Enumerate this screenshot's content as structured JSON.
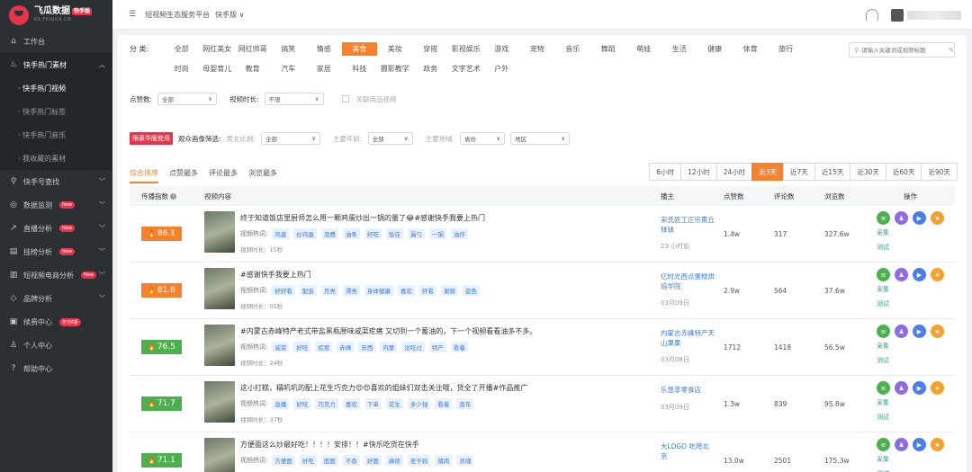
{
  "brand": {
    "name": "飞瓜数据",
    "edition": "快手版",
    "url": "KS.FEIGUA.CN"
  },
  "sidebar": {
    "items": [
      {
        "label": "工作台",
        "icon": "home-icon"
      },
      {
        "label": "快手热门素材",
        "icon": "fire-icon"
      },
      {
        "label": "快手号查找",
        "icon": "search-icon"
      },
      {
        "label": "数据监测",
        "icon": "monitor-icon",
        "badge": "New"
      },
      {
        "label": "直播分析",
        "icon": "live-icon",
        "badge": "New"
      },
      {
        "label": "挂榜分析",
        "icon": "chart-icon",
        "badge": "New"
      },
      {
        "label": "短视频电商分析",
        "icon": "bar-chart-icon",
        "badge": "New"
      },
      {
        "label": "品牌分析",
        "icon": "diamond-icon"
      },
      {
        "label": "续费中心",
        "icon": "wallet-icon",
        "badge": "年付6折"
      },
      {
        "label": "个人中心",
        "icon": "user-icon"
      },
      {
        "label": "帮助中心",
        "icon": "help-icon"
      }
    ],
    "subitems": [
      "· 快手热门视频",
      "· 快手热门标签",
      "· 快手热门音乐",
      "· 我收藏的素材"
    ]
  },
  "topbar": {
    "breadcrumb": "短视频生态服务平台",
    "platform": "快手版 ∨"
  },
  "filters": {
    "category_label": "分 类:",
    "categories": [
      "全部",
      "网红美女",
      "网红帅哥",
      "搞笑",
      "情感",
      "美食",
      "美妆",
      "穿搭",
      "影视娱乐",
      "游戏",
      "宠物",
      "音乐",
      "舞蹈",
      "萌娃",
      "生活",
      "健康",
      "体育",
      "旅行",
      "时尚",
      "母婴育儿",
      "教育",
      "汽车",
      "家居",
      "科技",
      "摄影教学",
      "政务",
      "文字艺术",
      "户外"
    ],
    "selected_category": "美食",
    "search_placeholder": "请输入关键词或视频标题",
    "likes_label": "点赞数:",
    "likes_value": "全部",
    "duration_label": "视频时长:",
    "duration_value": "不限",
    "linked_goods": "关联商品视频",
    "vip_tag": "限豪华版使用",
    "audience_label": "观众画像筛选:",
    "gender_label": "男女比例:",
    "gender_value": "全部",
    "age_label": "主要年龄:",
    "age_value": "全部",
    "region_label": "主要地域:",
    "region_value": "省份",
    "city_value": "地区"
  },
  "sort_tabs": [
    "综合排序",
    "点赞最多",
    "评论最多",
    "浏览最多"
  ],
  "time_ranges": [
    "6小时",
    "12小时",
    "24小时",
    "近3天",
    "近7天",
    "近15天",
    "近30天",
    "近60天",
    "近90天"
  ],
  "selected_range": "近3天",
  "table": {
    "headers": {
      "spread": "传播指数",
      "content": "视频内容",
      "author": "播主",
      "likes": "点赞数",
      "comments": "评论数",
      "views": "浏览数",
      "ops": "操作"
    },
    "hot_label": "视频热词:",
    "collect": "采集",
    "test": "测试",
    "rows": [
      {
        "score": "86.1",
        "color": "orange",
        "title": "终于知道饭店里厨师怎么用一颗鸡蛋炒出一锅的量了😂#感谢快手我要上热门",
        "keywords": [
          "鸡蛋",
          "炒鸡蛋",
          "浪费",
          "油条",
          "好吃",
          "饭店",
          "漏勺",
          "一锅",
          "油炸"
        ],
        "duration": "视频时长：15秒",
        "author": "宋氏匠工正宗熏丘钵钵",
        "date": "23 小时前",
        "likes": "1.4w",
        "comments": "317",
        "views": "327.6w"
      },
      {
        "score": "81.6",
        "color": "orange",
        "title": "#感谢快手我要上热门",
        "keywords": [
          "好好看",
          "配音",
          "月亮",
          "漂亮",
          "身体健康",
          "喜欢",
          "好看",
          "谢谢",
          "蓝色"
        ],
        "duration": "视频时长：55秒",
        "author": "亿时光西点蛋糕烘焙学院",
        "date": "03月09日",
        "likes": "2.9w",
        "comments": "564",
        "views": "37.6w"
      },
      {
        "score": "76.5",
        "color": "green",
        "title": "#内蒙古赤峰特产老式带盐黑瓶原味咸菜疙瘩 又切到一个蓄油的，下一个视频看看油多不多。",
        "keywords": [
          "咸菜",
          "好吃",
          "疙瘩",
          "赤峰",
          "东西",
          "内蒙",
          "没吃过",
          "特产",
          "看着"
        ],
        "duration": "视频时长：24秒",
        "author": "内蒙古赤峰特产天山果果",
        "date": "03月08日",
        "likes": "1712",
        "comments": "1418",
        "views": "56.5w"
      },
      {
        "score": "71.7",
        "color": "green",
        "title": "这小打糕，糯叽叽的配上花生巧克力😍😍喜欢的姐妹们双击关注哦，货全了开播#作品推广",
        "keywords": [
          "直播",
          "好吃",
          "巧克力",
          "喜欢",
          "下单",
          "花生",
          "多少钱",
          "看着",
          "直车"
        ],
        "duration": "视频时长：37秒",
        "author": "乐悠享零食店",
        "date": "03月09日",
        "likes": "1.3w",
        "comments": "839",
        "views": "95.8w"
      },
      {
        "score": "71.1",
        "color": "green",
        "title": "方便面这么炒最好吃！！！！安排！！#快乐吃货在快手",
        "keywords": [
          "方便面",
          "好吃",
          "面面",
          "不香",
          "好面",
          "麻烦",
          "老干妈",
          "猪肉",
          "灵魂"
        ],
        "duration": "",
        "author": "大LOGO 吃垮北京",
        "date": "",
        "likes": "13.0w",
        "comments": "2501",
        "views": "175.3w"
      }
    ]
  }
}
